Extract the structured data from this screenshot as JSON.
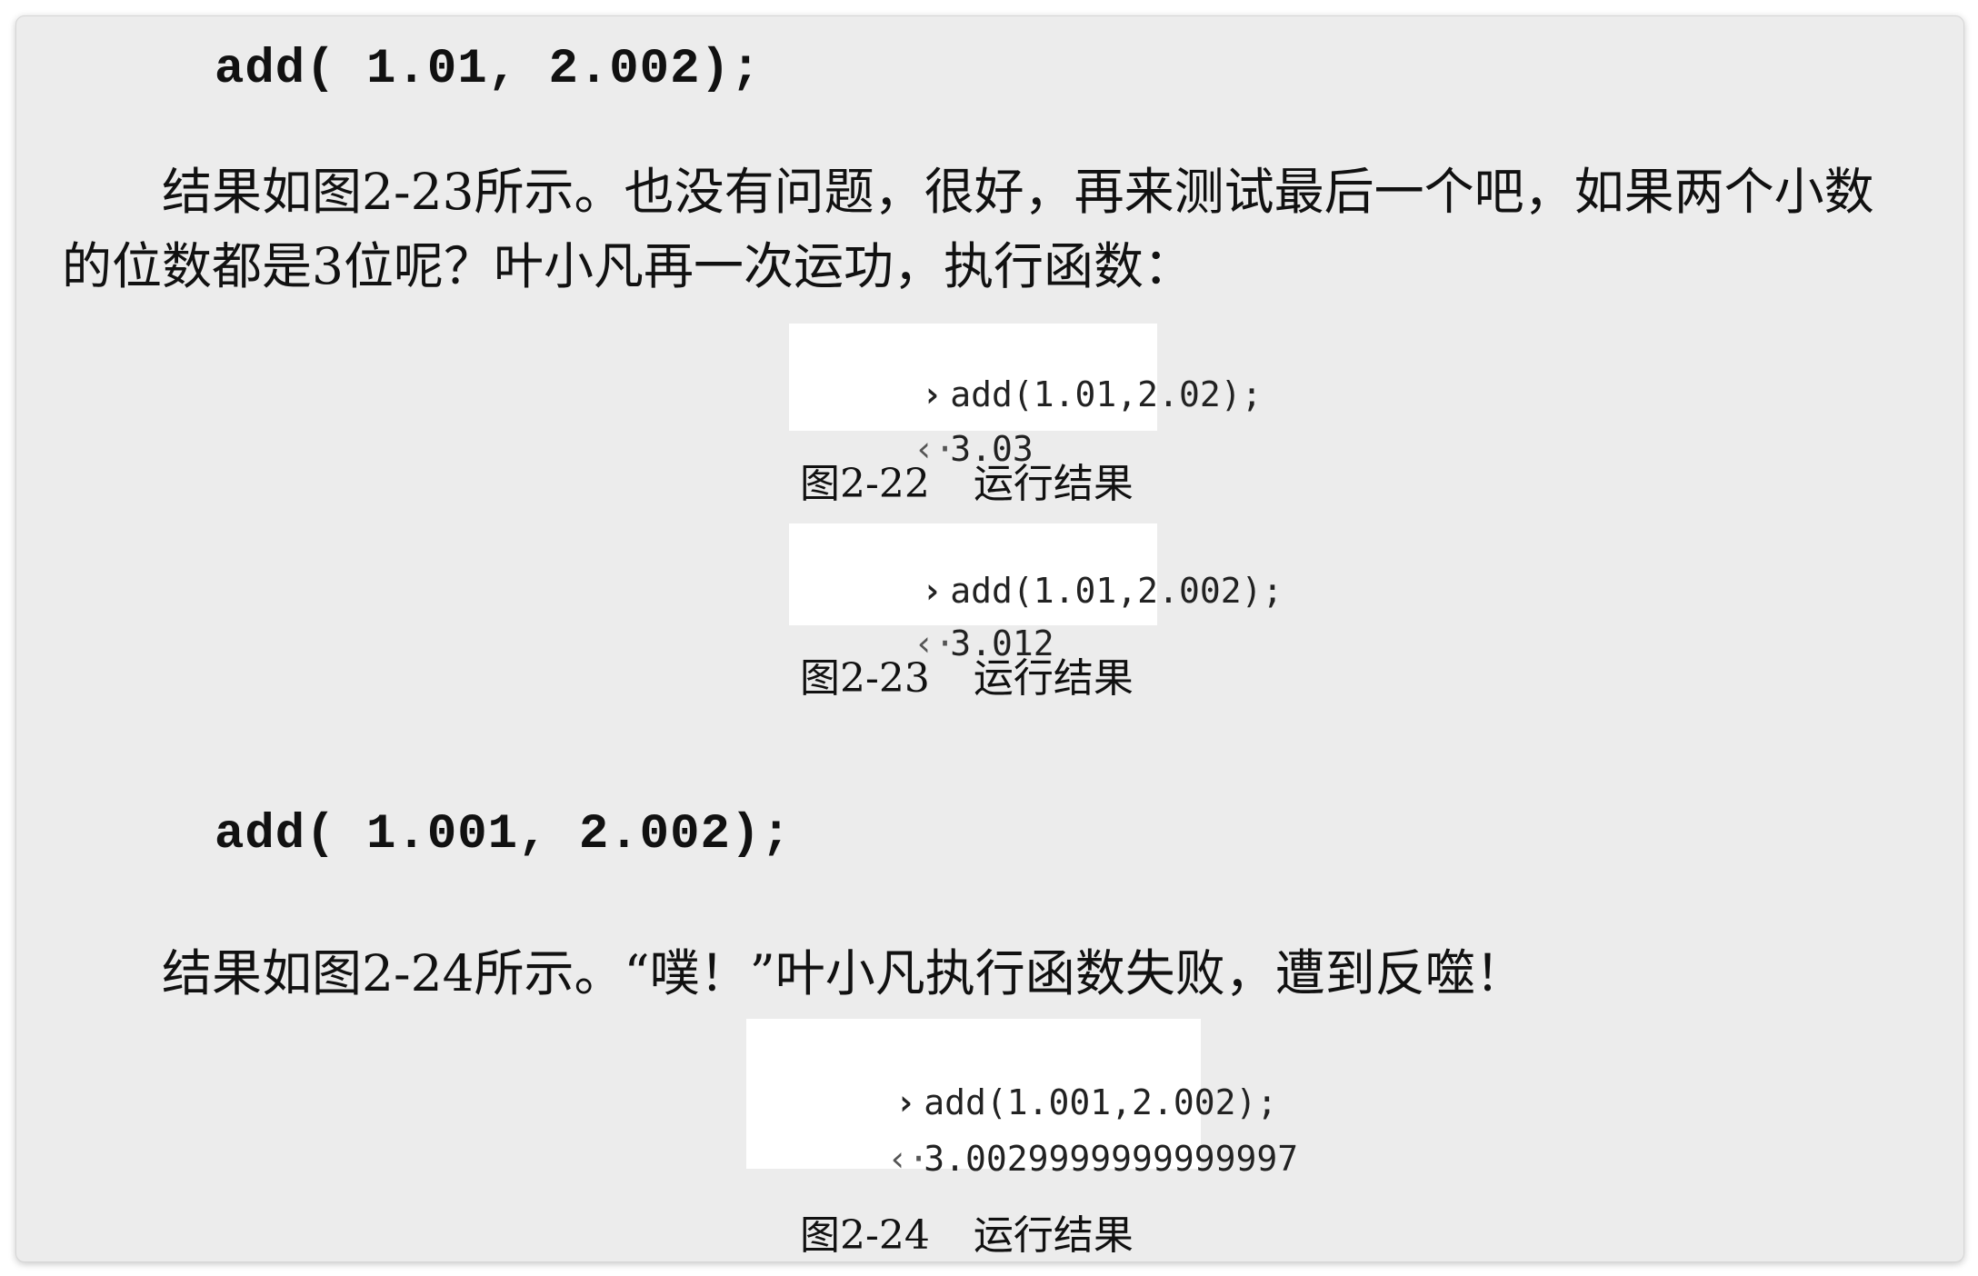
{
  "code": {
    "line1": "add( 1.01, 2.002);",
    "line2": "add( 1.001, 2.002);"
  },
  "paragraphs": {
    "p1_line1": "结果如图2-23所示。也没有问题，很好，再来测试最后一个吧，如果两个小数",
    "p1_line2": "的位数都是3位呢？叶小凡再一次运功，执行函数：",
    "p2": "结果如图2-24所示。“噗！”叶小凡执行函数失败，遭到反噬！"
  },
  "figures": [
    {
      "input_prompt": "›",
      "input": "add(1.01,2.02);",
      "output_prompt": "‹·",
      "output": "3.03",
      "caption_label": "图2-22",
      "caption_text": "运行结果"
    },
    {
      "input_prompt": "›",
      "input": "add(1.01,2.002);",
      "output_prompt": "‹·",
      "output": "3.012",
      "caption_label": "图2-23",
      "caption_text": "运行结果"
    },
    {
      "input_prompt": "›",
      "input": "add(1.001,2.002);",
      "output_prompt": "‹·",
      "output": "3.0029999999999997",
      "caption_label": "图2-24",
      "caption_text": "运行结果"
    }
  ]
}
